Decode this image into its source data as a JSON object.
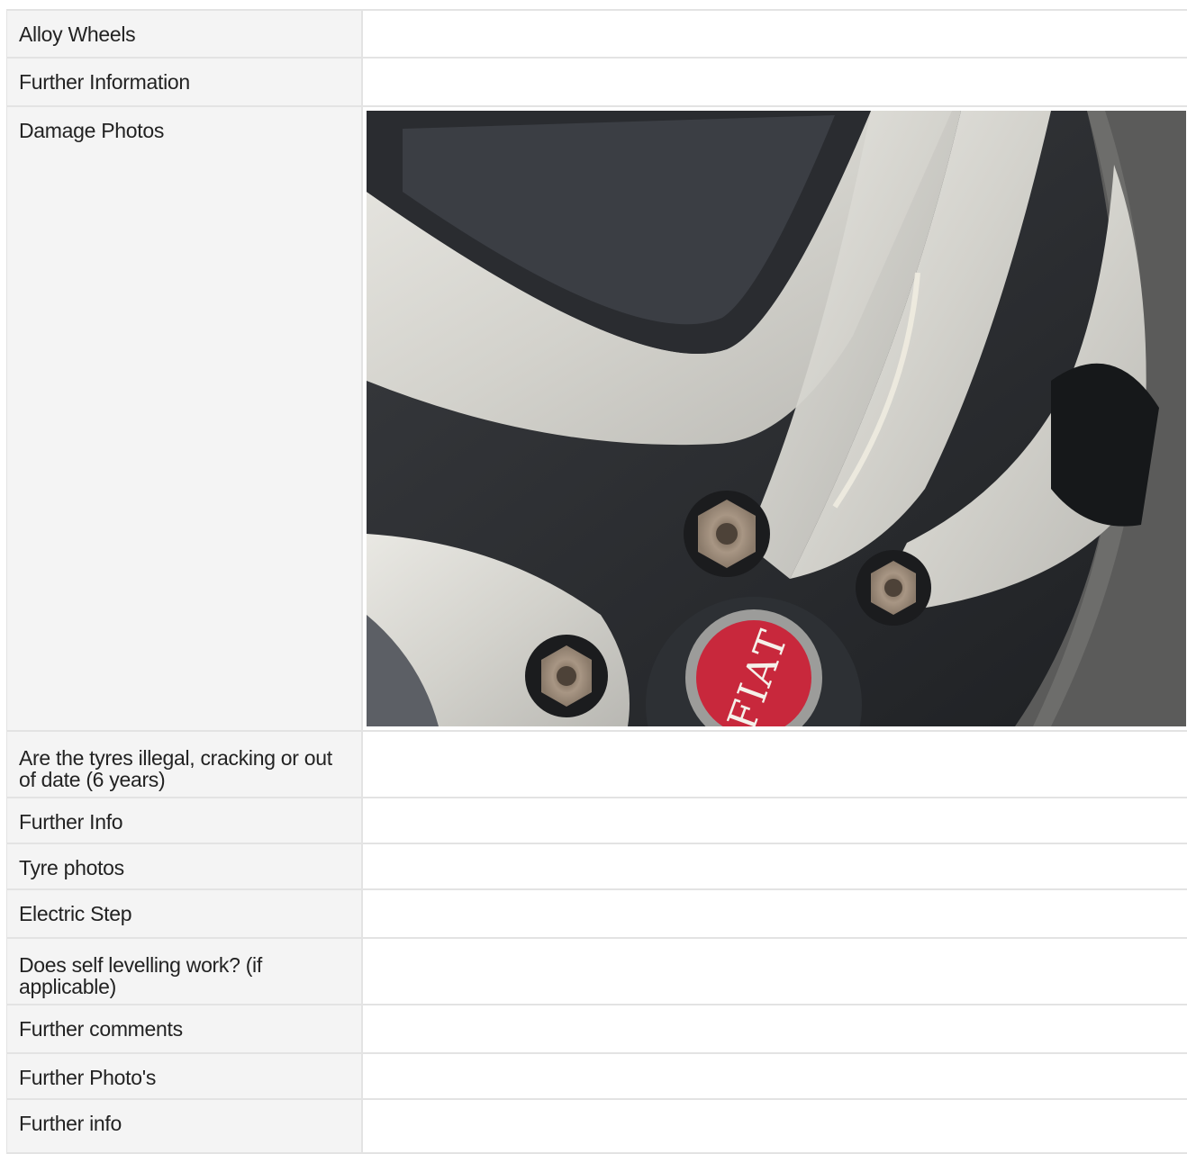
{
  "rows": [
    {
      "label": "Alloy Wheels",
      "value": ""
    },
    {
      "label": "Further Information",
      "value": ""
    },
    {
      "label": "Damage Photos",
      "value": "",
      "photo_subject": "alloy wheel with scuffed spoke",
      "photo_badge_text": "FIAT"
    },
    {
      "label": "Are the tyres illegal, cracking or out of date (6 years)",
      "value": ""
    },
    {
      "label": "Further Info",
      "value": ""
    },
    {
      "label": "Tyre photos",
      "value": ""
    },
    {
      "label": "Electric Step",
      "value": ""
    },
    {
      "label": "Does self levelling work? (if applicable)",
      "value": ""
    },
    {
      "label": "Further comments",
      "value": ""
    },
    {
      "label": "Further Photo's",
      "value": ""
    },
    {
      "label": "Further info",
      "value": ""
    }
  ],
  "colors": {
    "label_bg": "#f4f4f4",
    "border": "#e3e3e3",
    "badge_red": "#c8283c"
  }
}
